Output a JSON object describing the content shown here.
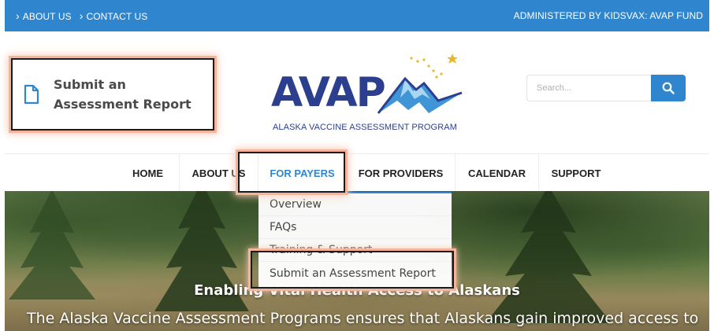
{
  "topbar": {
    "links": [
      "ABOUT US",
      "CONTACT US"
    ],
    "admin": "ADMINISTERED BY KIDSVAX: AVAP FUND"
  },
  "header": {
    "submit_label_line1": "Submit an",
    "submit_label_line2": "Assessment Report",
    "logo_word": "AVAP",
    "logo_subtitle": "ALASKA VACCINE ASSESSMENT PROGRAM",
    "search_placeholder": "Search..."
  },
  "nav": {
    "items": [
      "HOME",
      "ABOUT US",
      "FOR PAYERS",
      "FOR PROVIDERS",
      "CALENDAR",
      "SUPPORT"
    ],
    "active": "FOR PAYERS"
  },
  "dropdown": {
    "items": [
      "Overview",
      "FAQs",
      "Training & Support",
      "Submit an Assessment Report"
    ]
  },
  "hero": {
    "title": "Enabling Vital Health Access to Alaskans",
    "text": "The Alaska Vaccine Assessment Programs ensures that Alaskans gain improved access to"
  },
  "colors": {
    "brand_blue": "#2f86cf",
    "logo_navy": "#2c3f8f",
    "highlight": "#f4b39a",
    "star_gold": "#e8b923"
  },
  "icons": [
    "document-icon",
    "search-icon",
    "star-icon",
    "mountain-icon"
  ]
}
